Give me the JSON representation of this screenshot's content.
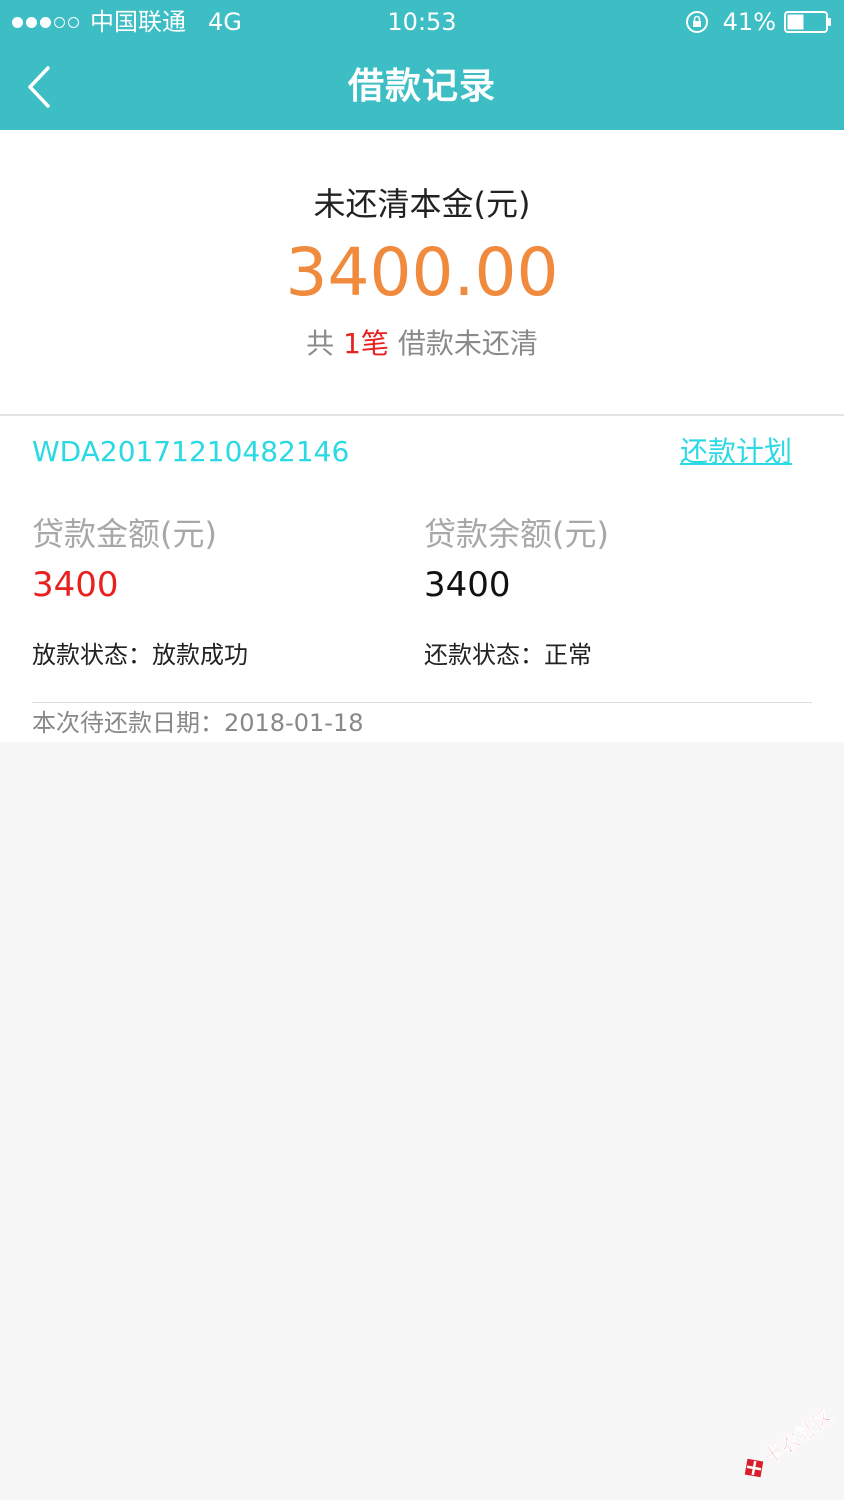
{
  "status_bar": {
    "carrier": "中国联通",
    "network": "4G",
    "time": "10:53",
    "battery": "41%",
    "signal_strength": 3
  },
  "nav": {
    "title": "借款记录",
    "back_icon": "chevron-left-icon"
  },
  "summary": {
    "label": "未还清本金(元)",
    "amount": "3400.00",
    "count_prefix": "共",
    "count_value": "1笔",
    "count_suffix": "借款未还清"
  },
  "loan": {
    "id": "WDA20171210482146",
    "plan_link": "还款计划",
    "loan_amount_label": "贷款金额(元)",
    "loan_amount_value": "3400",
    "balance_label": "贷款余额(元)",
    "balance_value": "3400",
    "disburse_status_label": "放款状态：",
    "disburse_status_value": "放款成功",
    "repay_status_label": "还款状态：",
    "repay_status_value": "正常",
    "due_date_label": "本次待还款日期：",
    "due_date_value": "2018-01-18"
  },
  "watermark": {
    "text": "卡农社区"
  },
  "colors": {
    "header": "#3dbdc4",
    "amount_orange": "#f08a3c",
    "accent_red": "#e8201e",
    "link_cyan": "#2ad9e4"
  }
}
